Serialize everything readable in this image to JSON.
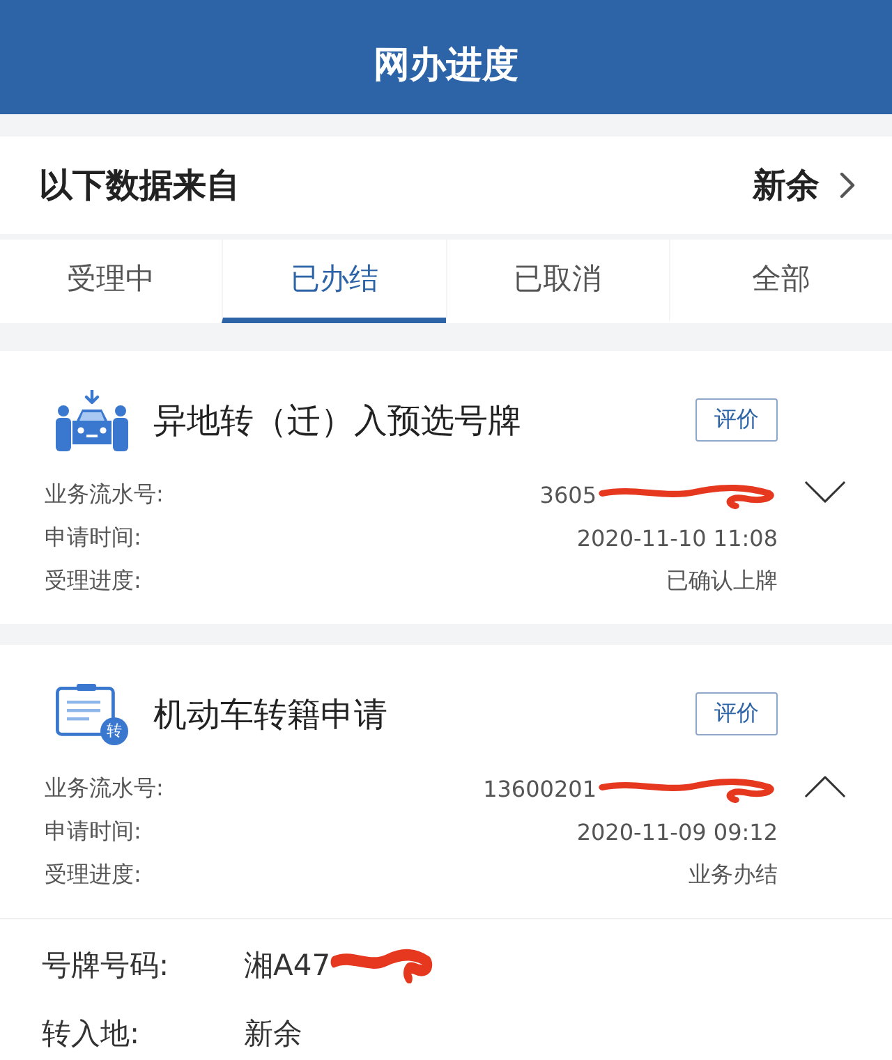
{
  "header": {
    "title": "网办进度"
  },
  "source": {
    "label": "以下数据来自",
    "value": "新余"
  },
  "tabs": [
    {
      "label": "受理中",
      "selected": false
    },
    {
      "label": "已办结",
      "selected": true
    },
    {
      "label": "已取消",
      "selected": false
    },
    {
      "label": "全部",
      "selected": false
    }
  ],
  "applications": [
    {
      "kind": "vehicle-transfer",
      "title": "异地转（迁）入预选号牌",
      "button": "评价",
      "expanded": false,
      "fields": [
        {
          "label": "业务流水号:",
          "value": "3605",
          "redacted": true
        },
        {
          "label": "申请时间:",
          "value": "2020-11-10 11:08",
          "redacted": false
        },
        {
          "label": "受理进度:",
          "value": "已确认上牌",
          "redacted": false
        }
      ]
    },
    {
      "kind": "document",
      "badge": "转",
      "title": "机动车转籍申请",
      "button": "评价",
      "expanded": true,
      "fields": [
        {
          "label": "业务流水号:",
          "value": "13600201",
          "redacted": true
        },
        {
          "label": "申请时间:",
          "value": "2020-11-09 09:12",
          "redacted": false
        },
        {
          "label": "受理进度:",
          "value": "业务办结",
          "redacted": false
        }
      ],
      "details": [
        {
          "label": "号牌号码:",
          "value": "湘A47",
          "redacted": true
        },
        {
          "label": "转入地:",
          "value": "新余",
          "redacted": false
        }
      ]
    }
  ]
}
